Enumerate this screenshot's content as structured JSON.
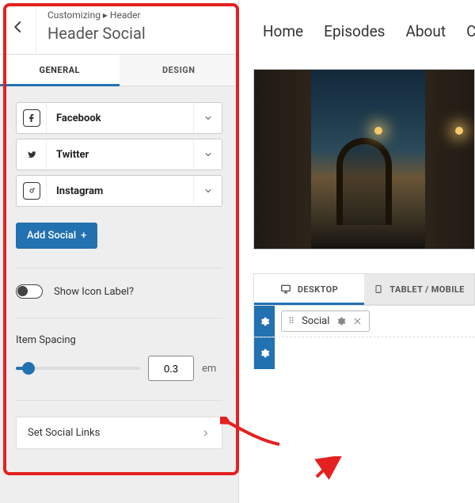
{
  "sidebar": {
    "breadcrumb": "Customizing ▸ Header",
    "title": "Header Social",
    "tabs": {
      "general": "GENERAL",
      "design": "DESIGN"
    },
    "socials": [
      {
        "label": "Facebook"
      },
      {
        "label": "Twitter"
      },
      {
        "label": "Instagram"
      }
    ],
    "add_label": "Add Social",
    "toggle_label": "Show Icon Label?",
    "spacing_label": "Item Spacing",
    "spacing_value": "0.3",
    "spacing_unit": "em",
    "set_links_label": "Set Social Links"
  },
  "preview": {
    "nav": [
      "Home",
      "Episodes",
      "About",
      "C"
    ],
    "device_tabs": {
      "desktop": "DESKTOP",
      "tablet": "TABLET / MOBILE"
    },
    "chip_label": "Social"
  }
}
